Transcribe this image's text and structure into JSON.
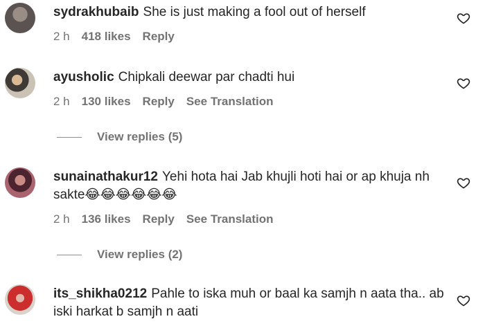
{
  "comments": [
    {
      "username": "sydrakhubaib",
      "text": "She is just making a fool out of herself",
      "age": "2 h",
      "likes": "418 likes",
      "reply_label": "Reply"
    },
    {
      "username": "ayusholic",
      "text": "Chipkali deewar par chadti hui",
      "age": "2 h",
      "likes": "130 likes",
      "reply_label": "Reply",
      "translation_label": "See Translation",
      "view_replies": "View replies (5)"
    },
    {
      "username": "sunainathakur12",
      "text": "Yehi hota hai Jab khujli hoti hai or ap khuja nh sakte😂😂😂😂😂😂",
      "age": "2 h",
      "likes": "136 likes",
      "reply_label": "Reply",
      "translation_label": "See Translation",
      "view_replies": "View replies (2)"
    },
    {
      "username": "its_shikha0212",
      "text": "Pahle to iska muh or baal ka samjh n aata tha.. ab iski harkat b samjh n aati"
    }
  ],
  "icons": {
    "like": "heart-outline-icon"
  }
}
